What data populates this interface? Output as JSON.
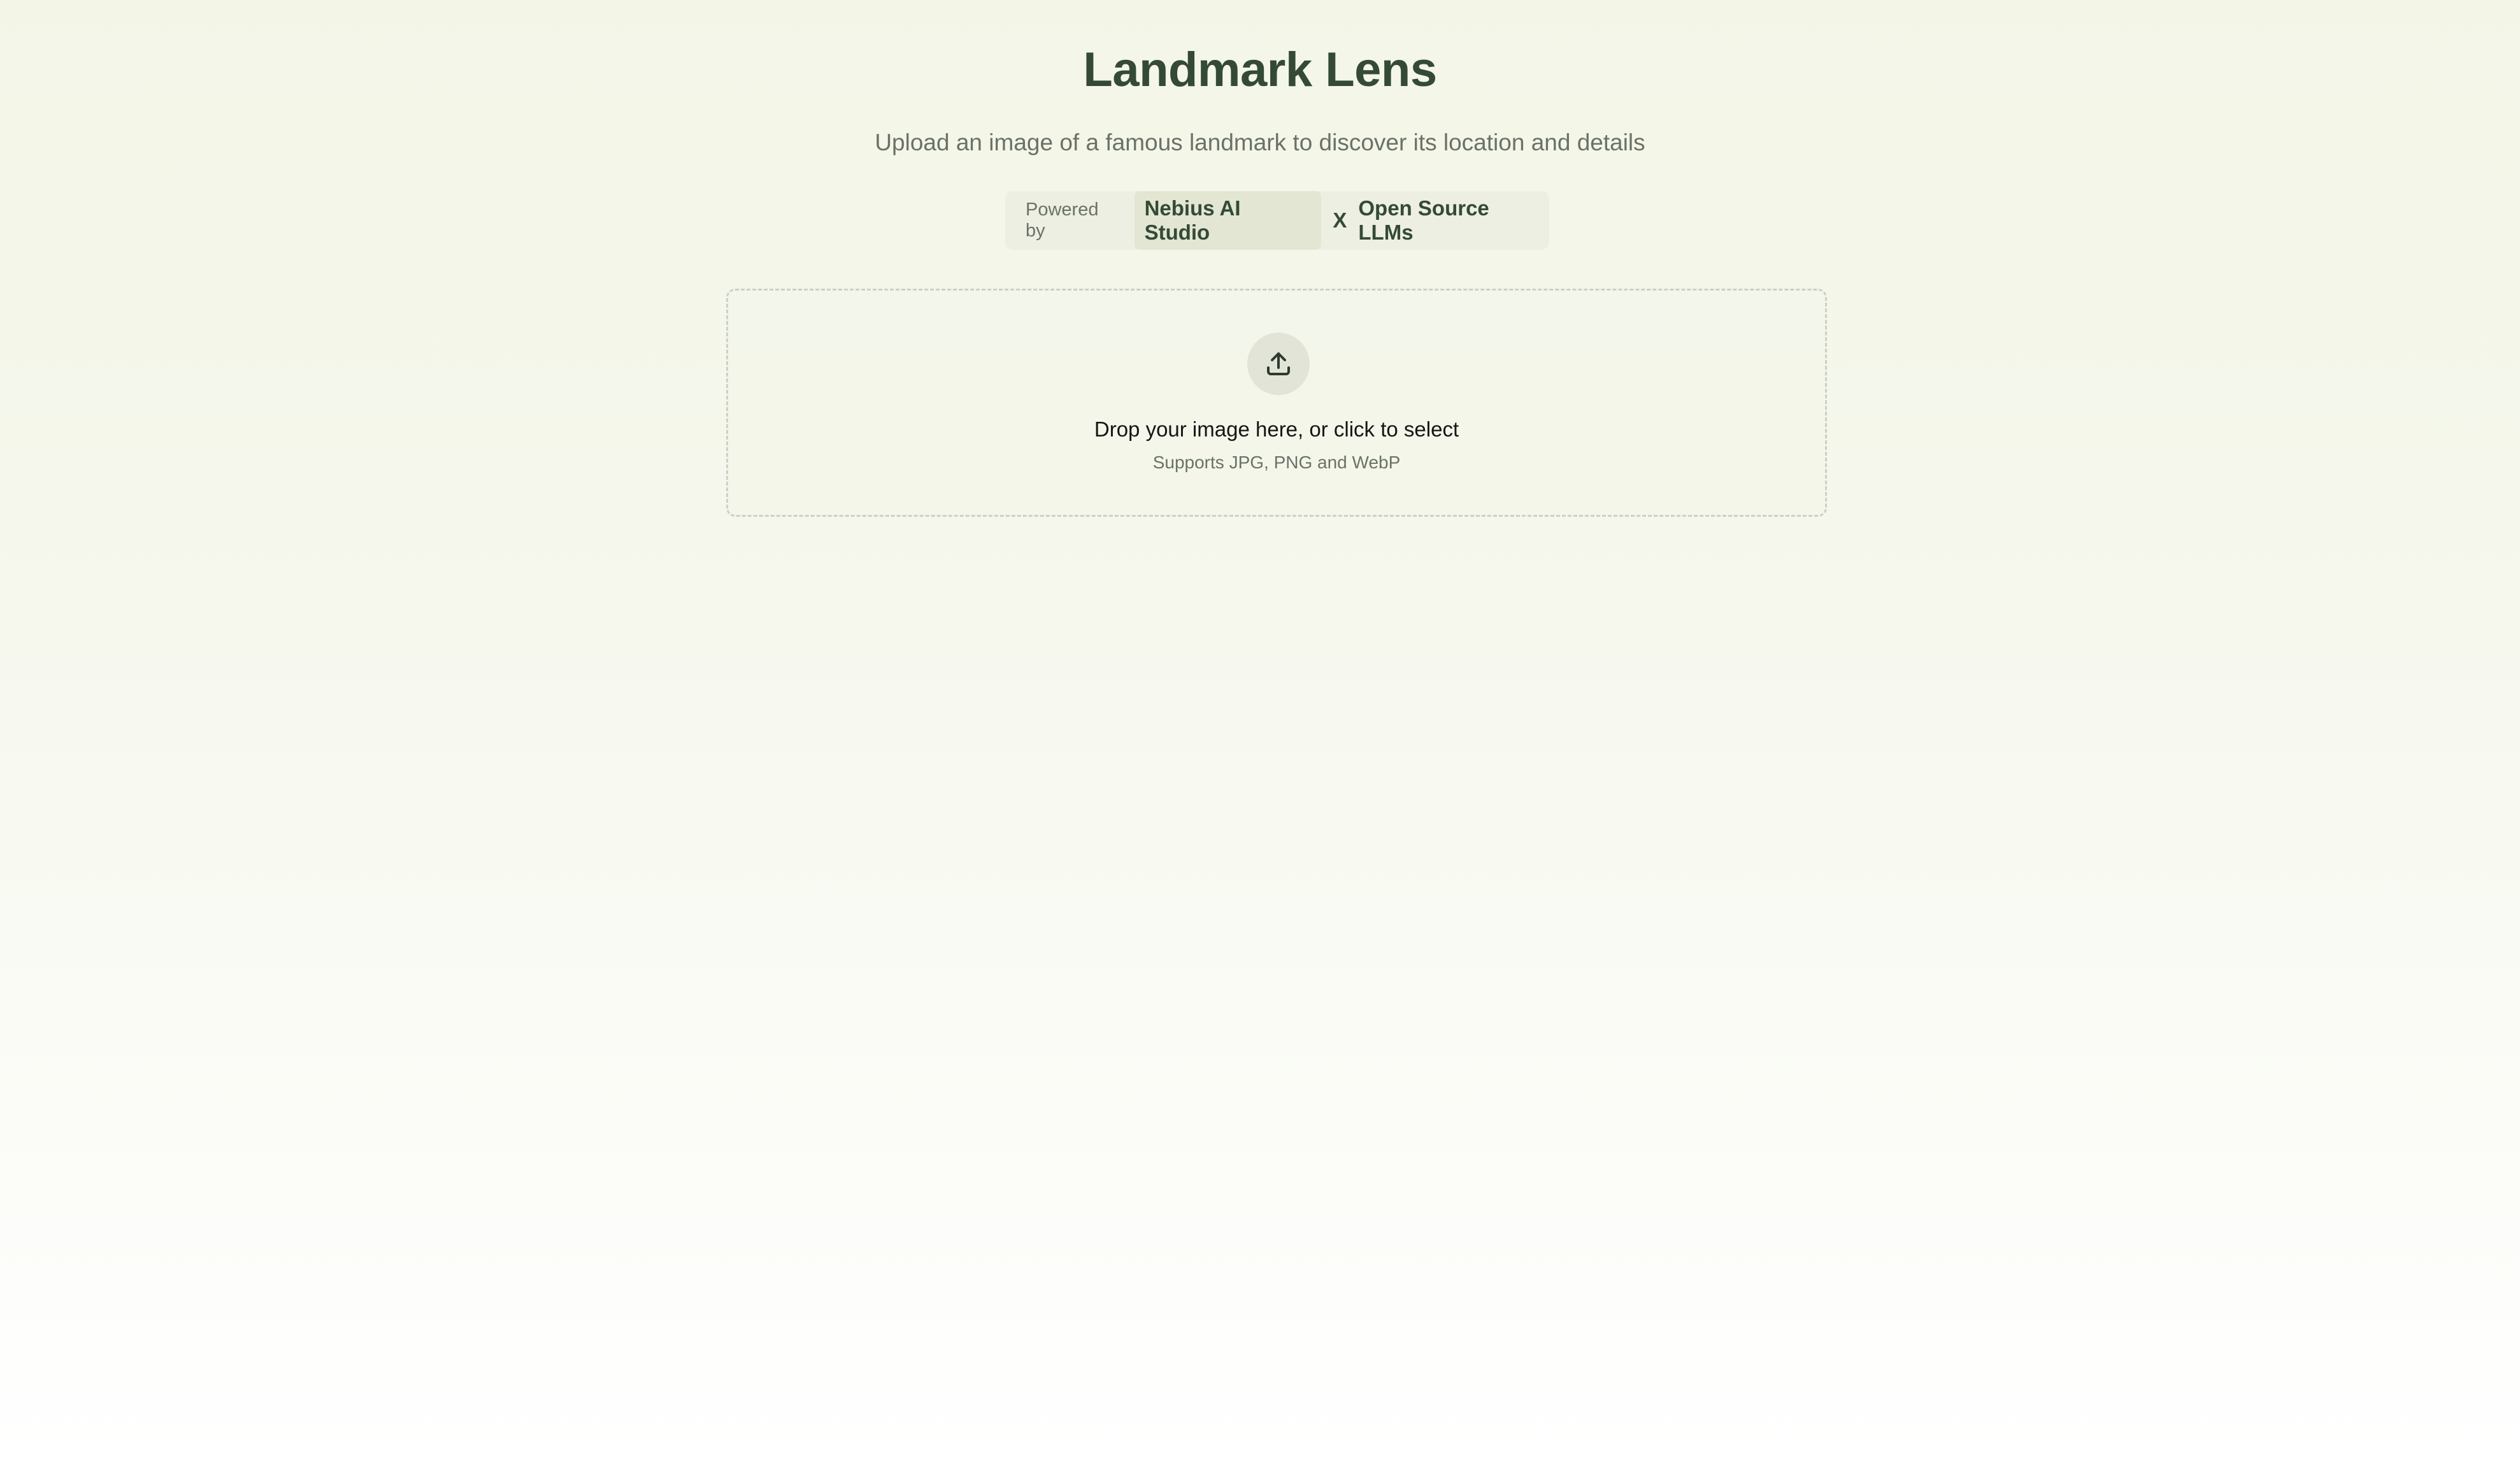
{
  "header": {
    "title": "Landmark Lens",
    "subtitle": "Upload an image of a famous landmark to discover its location and details"
  },
  "powered_by": {
    "label": "Powered by",
    "provider": "Nebius AI Studio",
    "separator": "X",
    "models": "Open Source LLMs"
  },
  "upload": {
    "icon": "upload-icon",
    "prompt": "Drop your image here, or click to select",
    "formats": "Supports JPG, PNG and WebP"
  },
  "colors": {
    "accent": "#344a37",
    "muted_text": "#6a7268",
    "background_top": "#f3f6e7",
    "background_bottom": "#ffffff"
  }
}
